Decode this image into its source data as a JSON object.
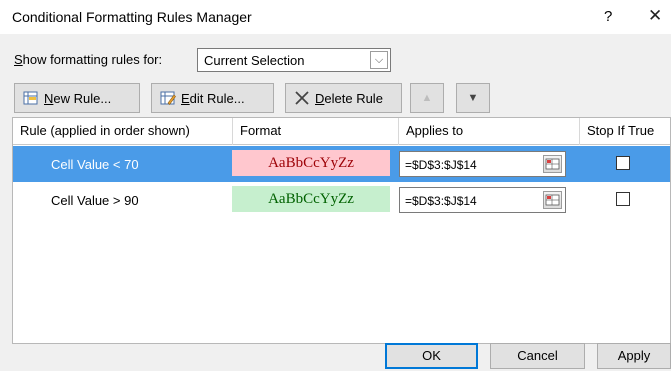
{
  "dialog": {
    "title": "Conditional Formatting Rules Manager",
    "help_glyph": "?",
    "close_glyph": "✕"
  },
  "show_rules": {
    "label_prefix": "S",
    "label_rest": "how formatting rules for:",
    "selected": "Current Selection",
    "dropdown_glyph": "⌵"
  },
  "toolbar": {
    "new_rule_u": "N",
    "new_rule_rest": "ew Rule...",
    "edit_rule_u": "E",
    "edit_rule_rest": "dit Rule...",
    "delete_rule_prefix": "",
    "delete_rule_u": "D",
    "delete_rule_rest": "elete Rule",
    "move_up_glyph": "▲",
    "move_down_glyph": "▼"
  },
  "columns": {
    "rule": "Rule (applied in order shown)",
    "format": "Format",
    "applies_to": "Applies to",
    "stop_if_true": "Stop If True"
  },
  "rules": [
    {
      "rule": "Cell Value < 70",
      "preview": "AaBbCcYyZz",
      "preview_bg": "#ffc7ce",
      "preview_color": "#9c0006",
      "applies_to": "=$D$3:$J$14",
      "stop_if_true": false,
      "selected": true
    },
    {
      "rule": "Cell Value > 90",
      "preview": "AaBbCcYyZz",
      "preview_bg": "#c6efce",
      "preview_color": "#006100",
      "applies_to": "=$D$3:$J$14",
      "stop_if_true": false,
      "selected": false
    }
  ],
  "buttons": {
    "ok": "OK",
    "cancel": "Cancel",
    "apply": "Apply"
  },
  "colors": {
    "selection": "#4a9be8",
    "accent": "#0078d7"
  }
}
